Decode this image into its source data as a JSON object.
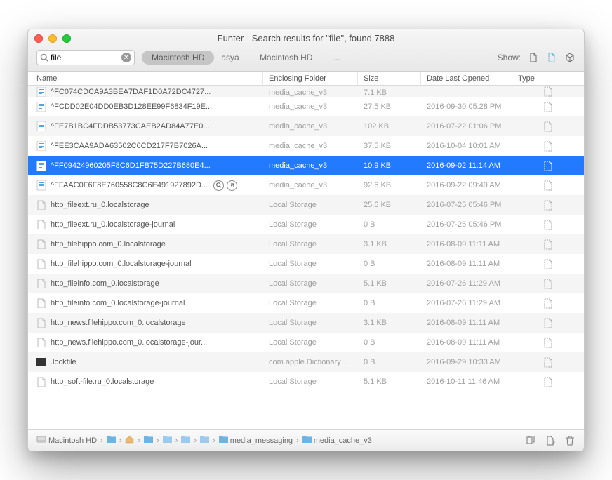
{
  "window_title": "Funter - Search results for \"file\", found 7888",
  "search_value": "file",
  "pill_label": "Macintosh HD",
  "path_crumbs": [
    "asya",
    "Macintosh HD",
    "..."
  ],
  "show_label": "Show:",
  "columns": {
    "name": "Name",
    "folder": "Enclosing Folder",
    "size": "Size",
    "date": "Date Last Opened",
    "type": "Type"
  },
  "breadcrumb": [
    {
      "label": "Macintosh HD",
      "icon": "disk"
    },
    {
      "label": "",
      "icon": "folder-blue"
    },
    {
      "label": "",
      "icon": "home"
    },
    {
      "label": "",
      "icon": "folder-blue"
    },
    {
      "label": "",
      "icon": "folder"
    },
    {
      "label": "",
      "icon": "folder"
    },
    {
      "label": "",
      "icon": "folder"
    },
    {
      "label": "media_messaging",
      "icon": "folder-blue"
    },
    {
      "label": "media_cache_v3",
      "icon": "folder-blue"
    }
  ],
  "rows": [
    {
      "icon": "doc",
      "name": "^FC074CDCA9A3BEA7DAF1D0A72DC4727...",
      "folder": "media_cache_v3",
      "size": "7.1 KB",
      "date": "",
      "hidden": true,
      "selected": false,
      "partial": true
    },
    {
      "icon": "doc",
      "name": "^FCDD02E04DD0EB3D128EE99F6834F19E...",
      "folder": "media_cache_v3",
      "size": "27.5 KB",
      "date": "2016-09-30 05:28 PM",
      "hidden": true,
      "selected": false,
      "partial": false
    },
    {
      "icon": "doc",
      "name": "^FE7B1BC4FDDB53773CAEB2AD84A77E0...",
      "folder": "media_cache_v3",
      "size": "102 KB",
      "date": "2016-07-22 01:06 PM",
      "hidden": true,
      "selected": false,
      "partial": false
    },
    {
      "icon": "doc",
      "name": "^FEE3CAA9ADA63502C6CD217F7B7026A...",
      "folder": "media_cache_v3",
      "size": "37.5 KB",
      "date": "2016-10-04 10:01 AM",
      "hidden": true,
      "selected": false,
      "partial": false
    },
    {
      "icon": "doc",
      "name": "^FF09424960205F8C6D1FB75D227B680E4...",
      "folder": "media_cache_v3",
      "size": "10.9 KB",
      "date": "2016-09-02 11:14 AM",
      "hidden": true,
      "selected": true,
      "partial": false
    },
    {
      "icon": "doc",
      "name": "^FFAAC0F6F8E760558C8C6E491927892D...",
      "folder": "media_cache_v3",
      "size": "92.6 KB",
      "date": "2016-09-22 09:49 AM",
      "hidden": true,
      "selected": false,
      "partial": false,
      "actions": true
    },
    {
      "icon": "blank",
      "name": "http_fileext.ru_0.localstorage",
      "folder": "Local Storage",
      "size": "25.6 KB",
      "date": "2016-07-25 05:46 PM",
      "hidden": false,
      "selected": false,
      "partial": false
    },
    {
      "icon": "blank",
      "name": "http_fileext.ru_0.localstorage-journal",
      "folder": "Local Storage",
      "size": "0 B",
      "date": "2016-07-25 05:46 PM",
      "hidden": false,
      "selected": false,
      "partial": false
    },
    {
      "icon": "blank",
      "name": "http_filehippo.com_0.localstorage",
      "folder": "Local Storage",
      "size": "3.1 KB",
      "date": "2016-08-09 11:11 AM",
      "hidden": false,
      "selected": false,
      "partial": false
    },
    {
      "icon": "blank",
      "name": "http_filehippo.com_0.localstorage-journal",
      "folder": "Local Storage",
      "size": "0 B",
      "date": "2016-08-09 11:11 AM",
      "hidden": false,
      "selected": false,
      "partial": false
    },
    {
      "icon": "blank",
      "name": "http_fileinfo.com_0.localstorage",
      "folder": "Local Storage",
      "size": "5.1 KB",
      "date": "2016-07-26 11:29 AM",
      "hidden": false,
      "selected": false,
      "partial": false
    },
    {
      "icon": "blank",
      "name": "http_fileinfo.com_0.localstorage-journal",
      "folder": "Local Storage",
      "size": "0 B",
      "date": "2016-07-26 11:29 AM",
      "hidden": false,
      "selected": false,
      "partial": false
    },
    {
      "icon": "blank",
      "name": "http_news.filehippo.com_0.localstorage",
      "folder": "Local Storage",
      "size": "3.1 KB",
      "date": "2016-08-09 11:11 AM",
      "hidden": false,
      "selected": false,
      "partial": false
    },
    {
      "icon": "blank",
      "name": "http_news.filehippo.com_0.localstorage-jour...",
      "folder": "Local Storage",
      "size": "0 B",
      "date": "2016-08-09 11:11 AM",
      "hidden": false,
      "selected": false,
      "partial": false
    },
    {
      "icon": "black",
      "name": ".lockfile",
      "folder": "com.apple.DictionaryS...",
      "size": "0 B",
      "date": "2016-09-29 10:33 AM",
      "hidden": false,
      "selected": false,
      "partial": false
    },
    {
      "icon": "blank",
      "name": "http_soft-file.ru_0.localstorage",
      "folder": "Local Storage",
      "size": "5.1 KB",
      "date": "2016-10-11 11:46 AM",
      "hidden": false,
      "selected": false,
      "partial": false
    }
  ]
}
